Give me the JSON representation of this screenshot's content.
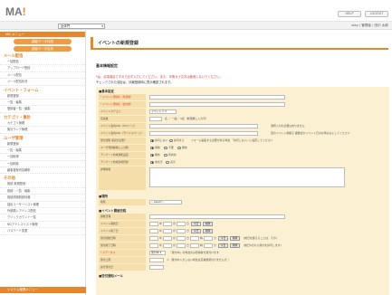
{
  "header": {
    "logo": "MA",
    "logo_dot": "!",
    "help": "HELP",
    "logout": "LOGOUT"
  },
  "userbar": {
    "select_value": "全体門",
    "user": "stay / 管理者 / 田中 太郎"
  },
  "sidebar": {
    "menu_head": "MA メニュー",
    "btn1": "顧客データ作成",
    "btn2": "顧客データ出荷",
    "sec_mail": "メール配信",
    "mail_items": [
      "一括配信",
      "アップロード配信",
      "メール配信",
      "メール配信状況"
    ],
    "sec_event": "イベント・フォーム",
    "event_items": [
      "新規登録",
      "一覧・編集",
      "登録者一覧・編集"
    ],
    "sec_cat": "カテゴリ・集計",
    "cat_items": [
      "カテゴリ管理",
      "集計ランク管理"
    ],
    "sec_user": "ユーザ管理",
    "user_items": [
      "新規登録",
      "一覧・編集",
      "一括取得",
      "一括削除",
      "顧客登録内容解析"
    ],
    "sec_other": "その他",
    "other_items": [
      "既読 新規登録",
      "既読・一覧・編集",
      "既読詳細既読情報",
      "抽出ユーザーリスト管理",
      "外部購入アドレス配信",
      "クリックカウント一覧",
      "NGアドレスリスト管理",
      "パスワード変更"
    ],
    "active": "システム管理メニュー"
  },
  "page": {
    "title": "イベントの新規登録",
    "section": "基本情報設定",
    "note1_req": "*は、必須項目ですので必ず入力してください。また、半角カナ文字は使用しないでください。",
    "note2": "チェックされた項目は、情報登録時に表示確認されます。"
  },
  "form": {
    "grp_basic": "■基本設定",
    "r_name": "* イベント登録名（外部用）",
    "r_name2": "* イベント登録名（社内用）",
    "r_cat": "イベントカテゴリ",
    "cat_value": "イベント１",
    "r_cap": "定員数",
    "cap_unit": "名 ／ 一般／ 0名（制限無し入力可）",
    "r_url1": "イベント案内URL（PCページ）",
    "url1_note": "選択入力の必要はありません",
    "r_url2": "イベント案内URL（モバイルページ）",
    "url2_note": "自分イベント用紙子 複数ほかイベント日のお申込みとしてください",
    "r_ent": "受付通知 承認が必要？",
    "ent_a": "許可しない",
    "ent_b": "許可する",
    "ent_note": "フォーム編集する必要がある場合 「許可しない」に設定してください",
    "r_notify": "ユーザ登録解除し入力時",
    "ntf_a": "通常",
    "ntf_b": "不要",
    "ntf_c": "無効",
    "r_mail1": "アンケート作成通知設定",
    "m1_a": "無効",
    "m1_b": "有効化",
    "r_mail2": "アンケート作成新規登録",
    "m2_a": "非表示",
    "m2_b": "表示",
    "r_desc": "詳細情報",
    "grp_place": "■場所",
    "r_place": "場所",
    "place_value": "-- select --",
    "grp_sched": "■イベント開催日程",
    "r_date_head": "開催日程",
    "r_d1": "イベント開始日",
    "r_d2": "イベント終了日",
    "r_d3": "受付開始日時",
    "r_d4": "受付終了日時",
    "y": "年",
    "m": "月",
    "d": "日",
    "h": "時",
    "mi": "分",
    "today": "今日",
    "clear": "削除",
    "d3_note": "(前日を超えることは、その)",
    "d4_note": "(前日5のから受付を許可します)",
    "r_status": "* ステータス",
    "status_value": "受付中",
    "status_note": "「受付中」の場合のみ登録者を受付けます",
    "r_lim": "受付上限",
    "lim_note": "人（受付中入力しない場合は定員数受付けませんが、）",
    "r_reserve": "先行受付日",
    "grp_mail": "■受付通知メール"
  }
}
